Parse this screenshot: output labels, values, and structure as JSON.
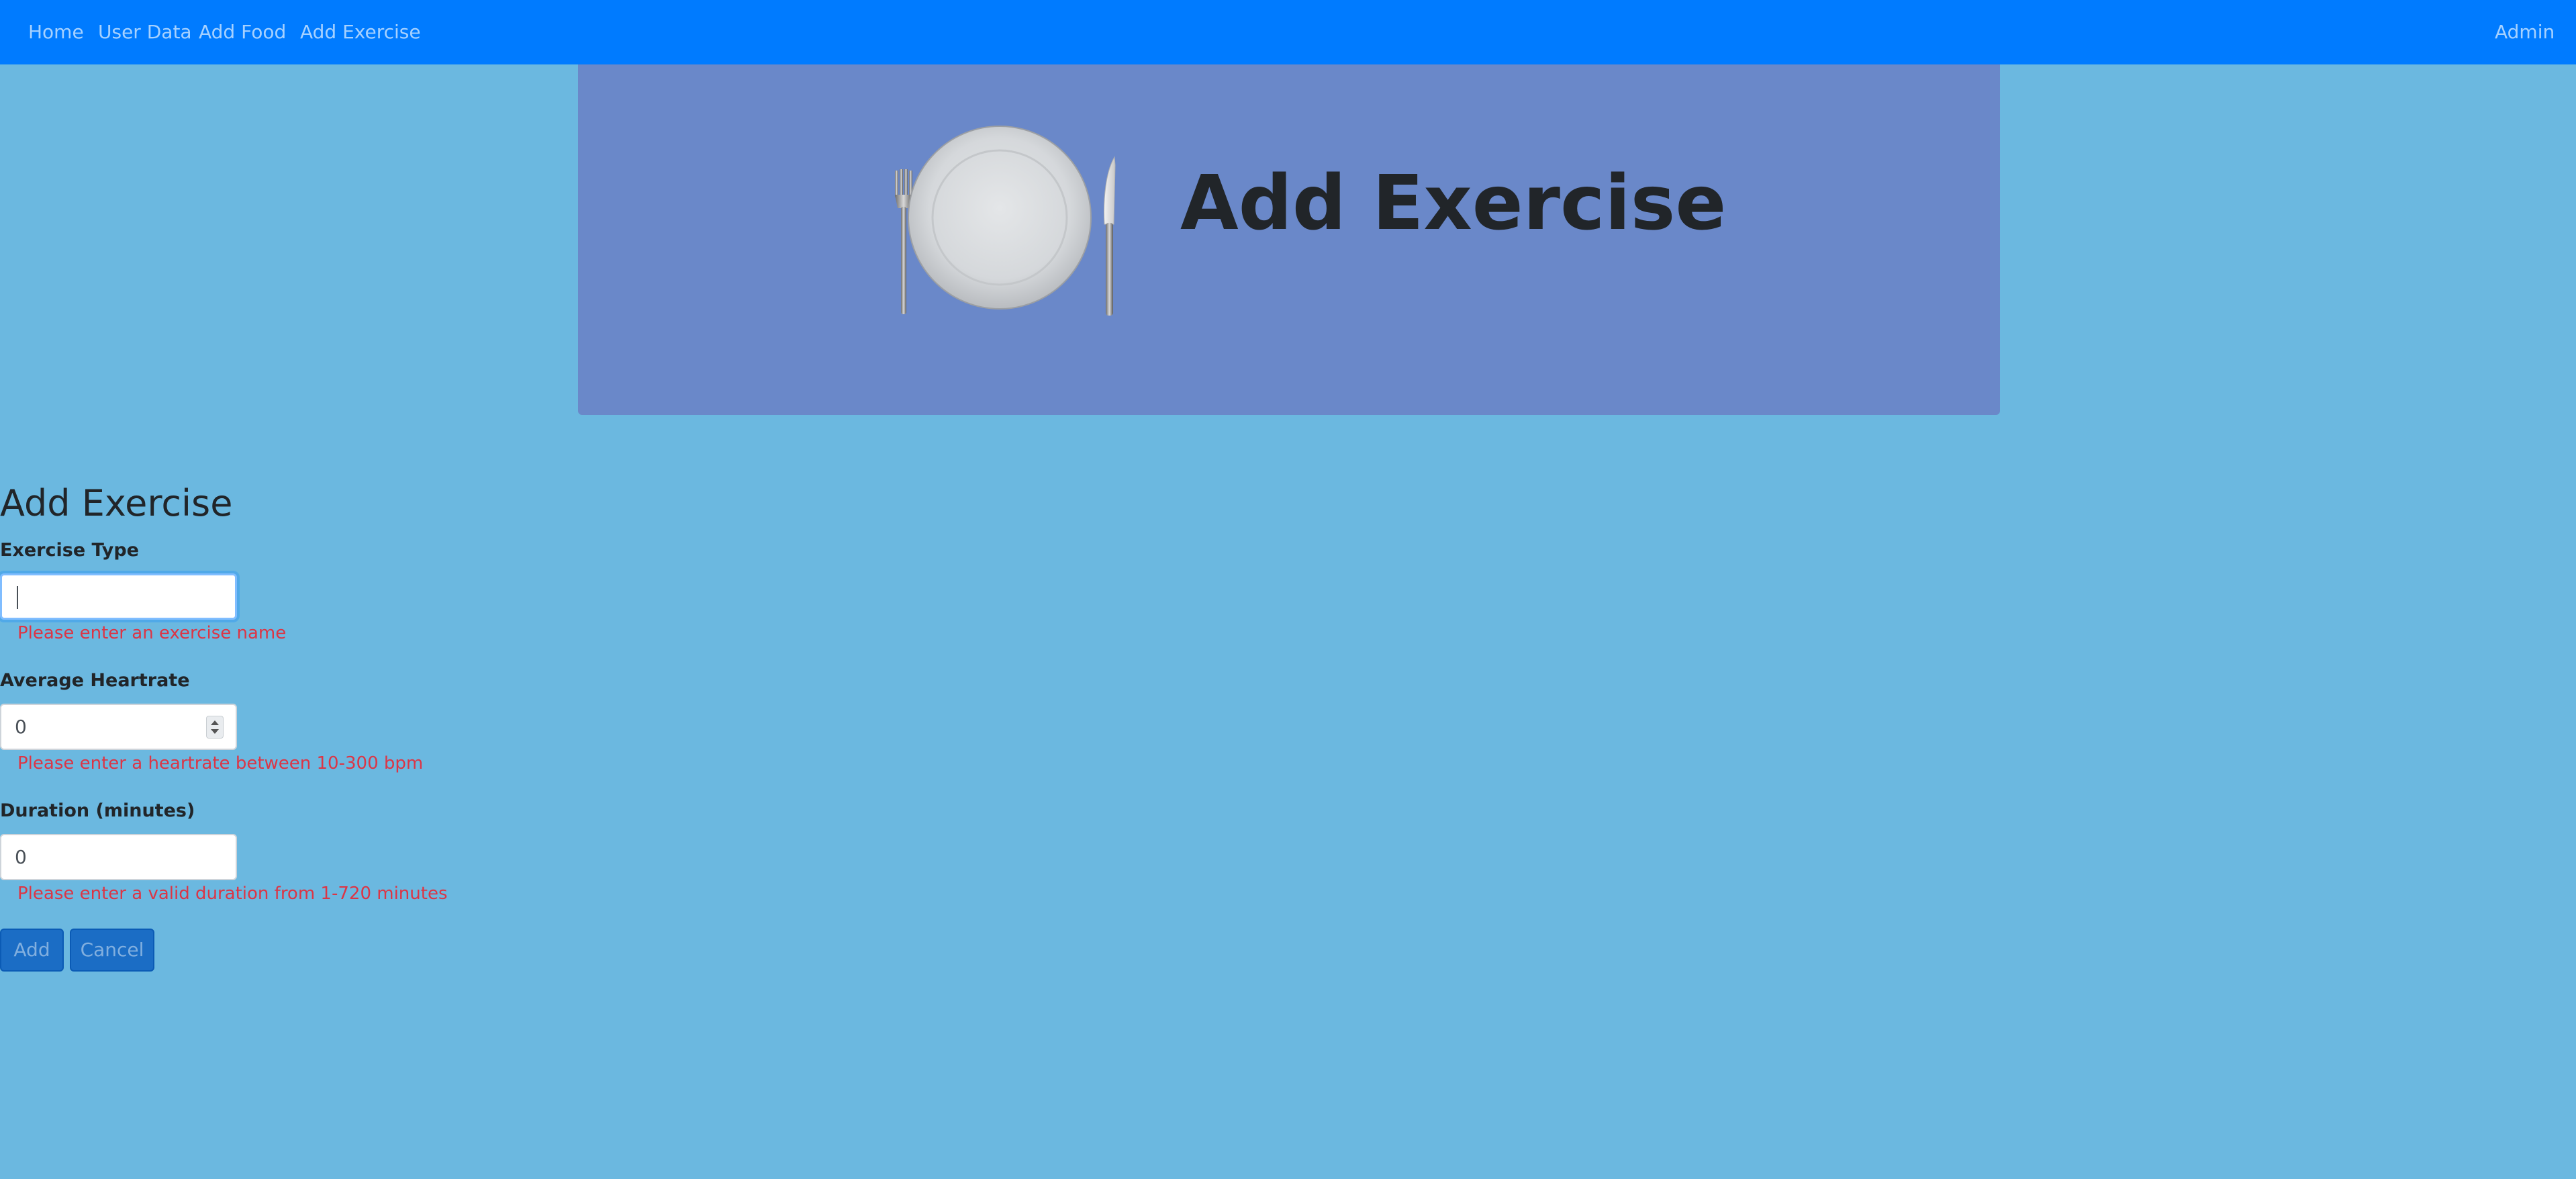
{
  "navbar": {
    "links": [
      "Home",
      "User Data",
      "Add Food",
      "Add Exercise"
    ],
    "user": "Admin"
  },
  "banner": {
    "title": "Add Exercise",
    "image_icon": "plate-fork-knife-icon"
  },
  "form": {
    "title": "Add Exercise",
    "fields": [
      {
        "label": "Exercise Type",
        "value": "",
        "placeholder": "",
        "error": "Please enter an exercise name"
      },
      {
        "label": "Average Heartrate",
        "value": "0",
        "placeholder": "",
        "error": "Please enter a heartrate between 10-300 bpm"
      },
      {
        "label": "Duration (minutes)",
        "value": "0",
        "placeholder": "",
        "error": "Please enter a valid duration from 1-720 minutes"
      }
    ],
    "buttons": {
      "add": "Add",
      "cancel": "Cancel"
    }
  },
  "colors": {
    "navbar": "#007bff",
    "page_background": "#6bb8e0",
    "banner_background": "#6a88c9",
    "error_text": "#dc3545",
    "button": "#1b6dc5"
  }
}
